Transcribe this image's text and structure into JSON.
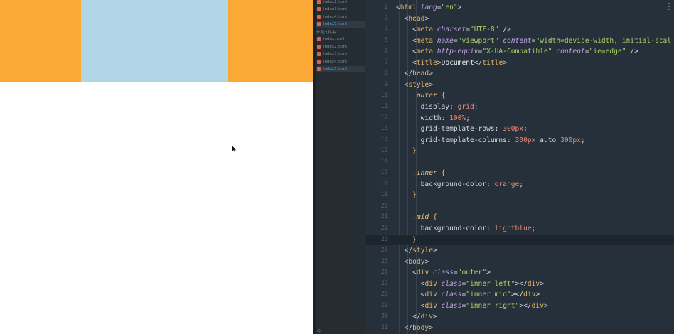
{
  "preview": {
    "colors": {
      "orange": "#fba834",
      "lightblue": "#b0d6e6"
    }
  },
  "sidebar": {
    "group1_files": [
      {
        "label": "index2.html",
        "active": false
      },
      {
        "label": "index3.html",
        "active": false
      },
      {
        "label": "index4.html",
        "active": false
      },
      {
        "label": "index5.html",
        "active": true
      }
    ],
    "folder_label": "外链文件夹",
    "group2_files": [
      {
        "label": "index.html",
        "active": false
      },
      {
        "label": "index2.html",
        "active": false
      },
      {
        "label": "index3.html",
        "active": false
      },
      {
        "label": "index4.html",
        "active": false
      },
      {
        "label": "index5.html",
        "active": true
      }
    ],
    "bottom_icon": "中"
  },
  "editor": {
    "lines": [
      {
        "n": "2",
        "tokens": [
          [
            "punc",
            "<"
          ],
          [
            "tag",
            "html"
          ],
          [
            "punc",
            " "
          ],
          [
            "attr",
            "lang"
          ],
          [
            "punc",
            "="
          ],
          [
            "str",
            "\"en\""
          ],
          [
            "punc",
            ">"
          ]
        ]
      },
      {
        "n": "3",
        "tokens": [
          [
            "punc",
            "  <"
          ],
          [
            "tag",
            "head"
          ],
          [
            "punc",
            ">"
          ]
        ]
      },
      {
        "n": "4",
        "tokens": [
          [
            "punc",
            "    <"
          ],
          [
            "tag",
            "meta"
          ],
          [
            "punc",
            " "
          ],
          [
            "attr",
            "charset"
          ],
          [
            "punc",
            "="
          ],
          [
            "str",
            "\"UTF-8\""
          ],
          [
            "punc",
            " />"
          ]
        ]
      },
      {
        "n": "5",
        "tokens": [
          [
            "punc",
            "    <"
          ],
          [
            "tag",
            "meta"
          ],
          [
            "punc",
            " "
          ],
          [
            "attr",
            "name"
          ],
          [
            "punc",
            "="
          ],
          [
            "str",
            "\"viewport\""
          ],
          [
            "punc",
            " "
          ],
          [
            "attr",
            "content"
          ],
          [
            "punc",
            "="
          ],
          [
            "str",
            "\"width=device-width, initial-scal"
          ]
        ]
      },
      {
        "n": "6",
        "tokens": [
          [
            "punc",
            "    <"
          ],
          [
            "tag",
            "meta"
          ],
          [
            "punc",
            " "
          ],
          [
            "attr",
            "http-equiv"
          ],
          [
            "punc",
            "="
          ],
          [
            "str",
            "\"X-UA-Compatible\""
          ],
          [
            "punc",
            " "
          ],
          [
            "attr",
            "content"
          ],
          [
            "punc",
            "="
          ],
          [
            "str",
            "\"ie=edge\""
          ],
          [
            "punc",
            " />"
          ]
        ]
      },
      {
        "n": "7",
        "tokens": [
          [
            "punc",
            "    <"
          ],
          [
            "tag",
            "title"
          ],
          [
            "punc",
            ">"
          ],
          [
            "text",
            "Document"
          ],
          [
            "punc",
            "</"
          ],
          [
            "tag",
            "title"
          ],
          [
            "punc",
            ">"
          ]
        ]
      },
      {
        "n": "8",
        "tokens": [
          [
            "punc",
            "  </"
          ],
          [
            "tag",
            "head"
          ],
          [
            "punc",
            ">"
          ]
        ]
      },
      {
        "n": "9",
        "tokens": [
          [
            "punc",
            "  <"
          ],
          [
            "tag",
            "style"
          ],
          [
            "punc",
            ">"
          ]
        ]
      },
      {
        "n": "10",
        "tokens": [
          [
            "punc",
            "    "
          ],
          [
            "sel",
            ".outer"
          ],
          [
            "brace",
            " {"
          ]
        ]
      },
      {
        "n": "11",
        "tokens": [
          [
            "prop",
            "      display: "
          ],
          [
            "val",
            "grid"
          ],
          [
            "punc",
            ";"
          ]
        ]
      },
      {
        "n": "12",
        "tokens": [
          [
            "prop",
            "      width: "
          ],
          [
            "num",
            "100%"
          ],
          [
            "punc",
            ";"
          ]
        ]
      },
      {
        "n": "13",
        "tokens": [
          [
            "prop",
            "      grid-template-rows: "
          ],
          [
            "num",
            "300px"
          ],
          [
            "punc",
            ";"
          ]
        ]
      },
      {
        "n": "14",
        "tokens": [
          [
            "prop",
            "      grid-template-columns: "
          ],
          [
            "num",
            "300px"
          ],
          [
            "prop",
            " auto "
          ],
          [
            "num",
            "300px"
          ],
          [
            "punc",
            ";"
          ]
        ]
      },
      {
        "n": "15",
        "tokens": [
          [
            "brace",
            "    }"
          ]
        ]
      },
      {
        "n": "16",
        "tokens": []
      },
      {
        "n": "17",
        "tokens": [
          [
            "punc",
            "    "
          ],
          [
            "sel",
            ".inner"
          ],
          [
            "brace",
            " {"
          ]
        ]
      },
      {
        "n": "18",
        "tokens": [
          [
            "prop",
            "      background-color: "
          ],
          [
            "val",
            "orange"
          ],
          [
            "punc",
            ";"
          ]
        ]
      },
      {
        "n": "19",
        "tokens": [
          [
            "brace",
            "    }"
          ]
        ]
      },
      {
        "n": "20",
        "tokens": []
      },
      {
        "n": "21",
        "tokens": [
          [
            "punc",
            "    "
          ],
          [
            "sel",
            ".mid"
          ],
          [
            "brace",
            " {"
          ]
        ]
      },
      {
        "n": "22",
        "tokens": [
          [
            "prop",
            "      background-color: "
          ],
          [
            "val",
            "lightblue"
          ],
          [
            "punc",
            ";"
          ]
        ]
      },
      {
        "n": "23",
        "tokens": [
          [
            "brace",
            "    }"
          ]
        ],
        "current": true
      },
      {
        "n": "24",
        "tokens": [
          [
            "punc",
            "  </"
          ],
          [
            "tag",
            "style"
          ],
          [
            "punc",
            ">"
          ]
        ]
      },
      {
        "n": "25",
        "tokens": [
          [
            "punc",
            "  <"
          ],
          [
            "tag",
            "body"
          ],
          [
            "punc",
            ">"
          ]
        ]
      },
      {
        "n": "26",
        "tokens": [
          [
            "punc",
            "    <"
          ],
          [
            "tag",
            "div"
          ],
          [
            "punc",
            " "
          ],
          [
            "attr",
            "class"
          ],
          [
            "punc",
            "="
          ],
          [
            "str",
            "\"outer\""
          ],
          [
            "punc",
            ">"
          ]
        ]
      },
      {
        "n": "27",
        "tokens": [
          [
            "punc",
            "      <"
          ],
          [
            "tag",
            "div"
          ],
          [
            "punc",
            " "
          ],
          [
            "attr",
            "class"
          ],
          [
            "punc",
            "="
          ],
          [
            "str",
            "\"inner left\""
          ],
          [
            "punc",
            "></"
          ],
          [
            "tag",
            "div"
          ],
          [
            "punc",
            ">"
          ]
        ]
      },
      {
        "n": "28",
        "tokens": [
          [
            "punc",
            "      <"
          ],
          [
            "tag",
            "div"
          ],
          [
            "punc",
            " "
          ],
          [
            "attr",
            "class"
          ],
          [
            "punc",
            "="
          ],
          [
            "str",
            "\"inner mid\""
          ],
          [
            "punc",
            "></"
          ],
          [
            "tag",
            "div"
          ],
          [
            "punc",
            ">"
          ]
        ]
      },
      {
        "n": "29",
        "tokens": [
          [
            "punc",
            "      <"
          ],
          [
            "tag",
            "div"
          ],
          [
            "punc",
            " "
          ],
          [
            "attr",
            "class"
          ],
          [
            "punc",
            "="
          ],
          [
            "str",
            "\"inner right\""
          ],
          [
            "punc",
            "></"
          ],
          [
            "tag",
            "div"
          ],
          [
            "punc",
            ">"
          ]
        ]
      },
      {
        "n": "30",
        "tokens": [
          [
            "punc",
            "    </"
          ],
          [
            "tag",
            "div"
          ],
          [
            "punc",
            ">"
          ]
        ]
      },
      {
        "n": "31",
        "tokens": [
          [
            "punc",
            "  </"
          ],
          [
            "tag",
            "body"
          ],
          [
            "punc",
            ">"
          ]
        ]
      }
    ]
  }
}
